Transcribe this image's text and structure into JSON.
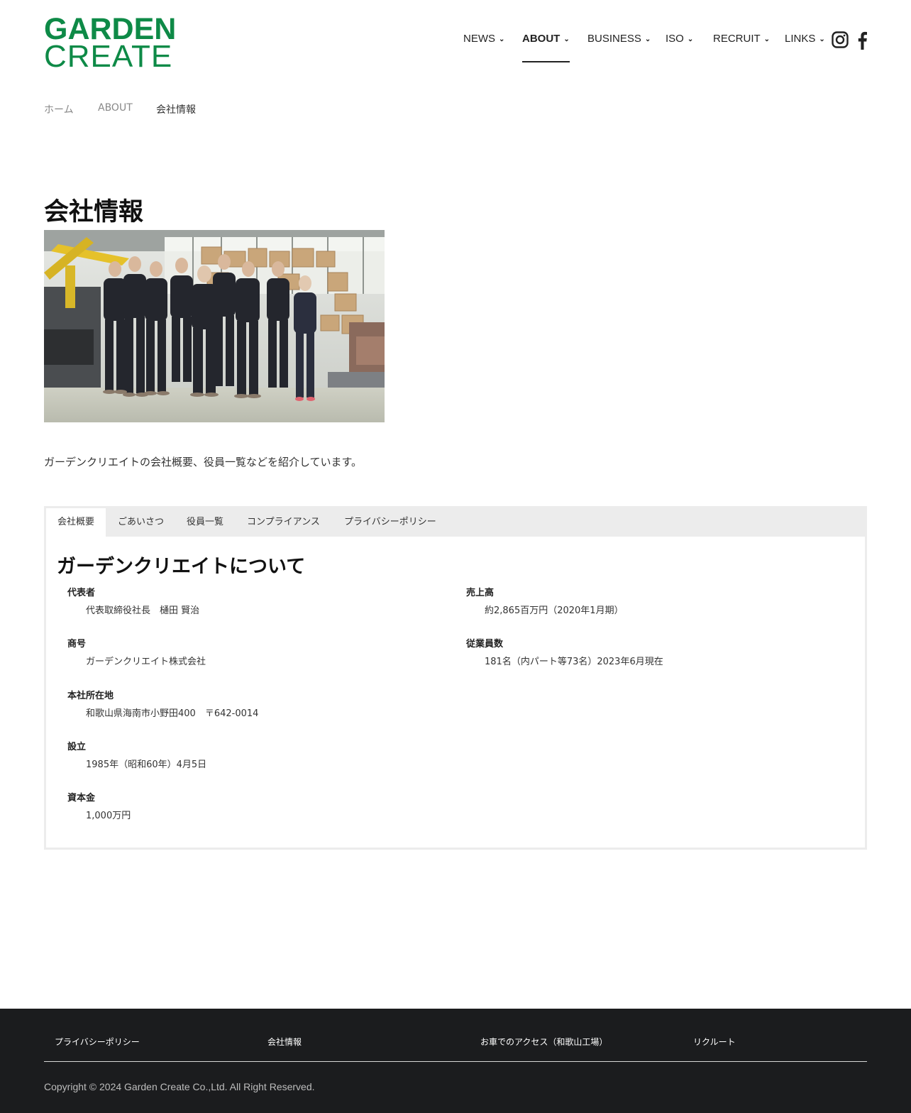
{
  "logo": {
    "line1": "GARDEN",
    "line2": "CREATE"
  },
  "nav": {
    "items": [
      {
        "label": "NEWS"
      },
      {
        "label": "ABOUT"
      },
      {
        "label": "BUSINESS"
      },
      {
        "label": "ISO"
      },
      {
        "label": "RECRUIT"
      },
      {
        "label": "LINKS"
      }
    ],
    "active": "ABOUT",
    "chevron": "❯"
  },
  "social": {
    "icons": [
      "instagram-icon",
      "facebook-icon"
    ]
  },
  "breadcrumb": [
    "ホーム",
    "ABOUT",
    "会社情報"
  ],
  "page": {
    "title": "会社情報",
    "intro": "ガーデンクリエイトの会社概要、役員一覧などを紹介しています。"
  },
  "tabs": [
    "会社概要",
    "ごあいさつ",
    "役員一覧",
    "コンプライアンス",
    "プライバシーポリシー"
  ],
  "active_tab": "会社概要",
  "section": {
    "title": "ガーデンクリエイトについて",
    "left": [
      {
        "term": "代表者",
        "value": "代表取締役社長　樋田 賢治"
      },
      {
        "term": "商号",
        "value": "ガーデンクリエイト株式会社"
      },
      {
        "term": "本社所在地",
        "value": "和歌山県海南市小野田400　〒642-0014"
      },
      {
        "term": "設立",
        "value": "1985年（昭和60年）4月5日"
      },
      {
        "term": "資本金",
        "value": "1,000万円"
      }
    ],
    "right": [
      {
        "term": "売上高",
        "value": "約2,865百万円（2020年1月期）"
      },
      {
        "term": "従業員数",
        "value": "181名（内パート等73名）2023年6月現在"
      }
    ]
  },
  "footer": {
    "links": [
      "プライバシーポリシー",
      "会社情報",
      "お車でのアクセス（和歌山工場）",
      "リクルート"
    ],
    "copyright": "Copyright © 2024 Garden Create Co.,Ltd. All Right Reserved."
  },
  "colors": {
    "brand": "#0e8a47",
    "footer_bg": "#1b1c1e",
    "tab_bar": "#ececec"
  }
}
